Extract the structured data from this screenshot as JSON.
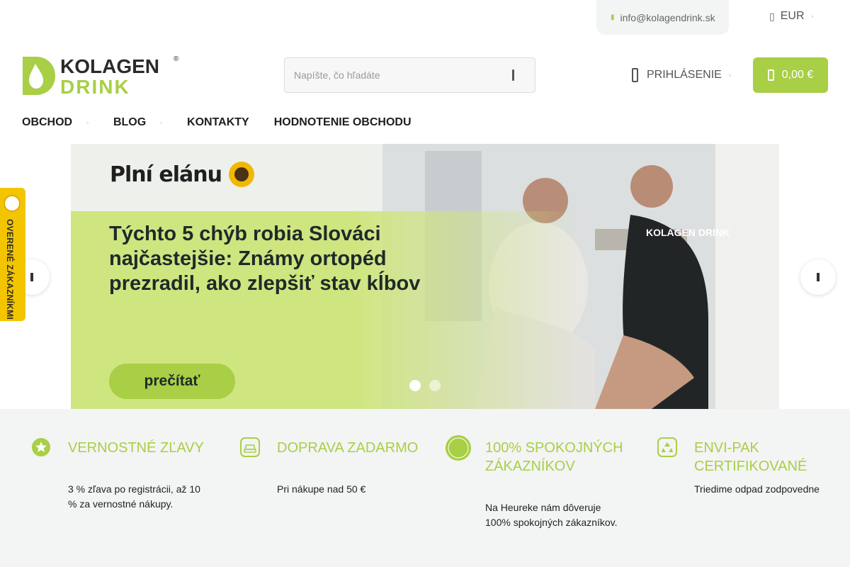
{
  "topbar": {
    "email": "info@kolagendrink.sk",
    "currency": "EUR"
  },
  "logo": {
    "line1": "KOLAGEN",
    "line2": "DRINK",
    "registered": "®",
    "green": "#a8cf45"
  },
  "search": {
    "placeholder": "Napíšte, čo hľadáte"
  },
  "header": {
    "login_label": "PRIHLÁSENIE",
    "cart_total": "0,00 €"
  },
  "nav": {
    "items": [
      {
        "label": "OBCHOD",
        "has_dropdown": true
      },
      {
        "label": "BLOG",
        "has_dropdown": true
      },
      {
        "label": "KONTAKTY",
        "has_dropdown": false
      },
      {
        "label": "HODNOTENIE OBCHODU",
        "has_dropdown": false
      }
    ]
  },
  "hero": {
    "brand_title": "Plní elánu",
    "headline": "Týchto 5 chýb robia Slováci najčastejšie: Známy ortopéd prezradil, ako zlepšiť stav kĺbov",
    "button_label": "prečítať",
    "shirt_logo": "KOLAGEN DRINK",
    "slides": 2,
    "active_slide": 1
  },
  "side_badge": {
    "label": "OVERENÉ ZÁKAZNÍKMI"
  },
  "benefits": [
    {
      "icon": "star-icon",
      "title": "VERNOSTNÉ ZĽAVY",
      "desc": "3 % zľava po registrácii, až 10 % za vernostné nákupy."
    },
    {
      "icon": "car-icon",
      "title": "DOPRAVA ZADARMO",
      "desc": "Pri nákupe nad 50 €"
    },
    {
      "icon": "verified-badge-icon",
      "title": "100% SPOKOJNÝCH ZÁKAZNÍKOV",
      "desc": "Na Heureke nám dôveruje 100% spokojných zákazníkov.",
      "badge_text": "OVERENÉ ZÁKAZNÍKMI"
    },
    {
      "icon": "recycle-icon",
      "title": "ENVI-PAK CERTIFIKOVANÉ",
      "desc": "Triedime odpad zodpovedne"
    }
  ],
  "colors": {
    "accent": "#a8cf45",
    "badge_yellow": "#f2c500",
    "light_bg": "#f3f4f4"
  }
}
